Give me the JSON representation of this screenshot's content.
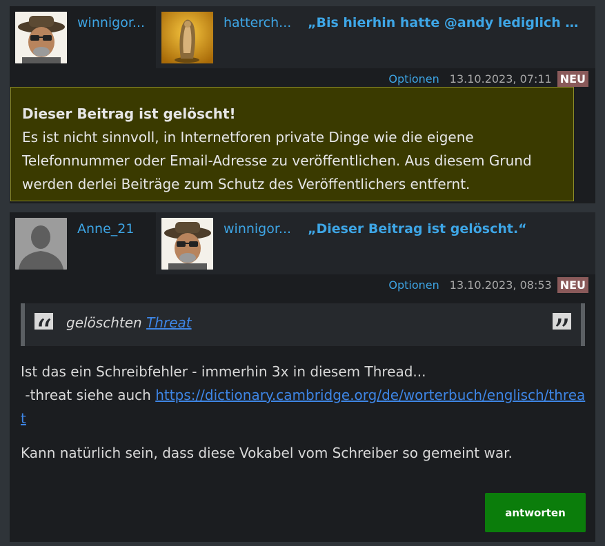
{
  "posts": [
    {
      "author": "winnigor...",
      "author_avatar_icon": "user-avatar-hat-icon",
      "reply_to": {
        "author": "hatterch...",
        "avatar_icon": "trophy-figure-avatar-icon",
        "quote": "„Bis hierhin hatte @andy lediglich m…"
      },
      "options_label": "Optionen",
      "timestamp": "13.10.2023, 07:11",
      "badge": "NEU",
      "deleted": {
        "title": "Dieser Beitrag ist gelöscht!",
        "text": "Es ist nicht sinnvoll, in Internetforen private Dinge wie die eigene Telefonnummer oder Email-Adresse zu veröffentlichen. Aus diesem Grund werden derlei Beiträge zum Schutz des Veröffentlichers entfernt."
      }
    },
    {
      "author": "Anne_21",
      "author_avatar_icon": "default-user-silhouette-icon",
      "reply_to": {
        "author": "winnigor...",
        "avatar_icon": "user-avatar-hat-icon",
        "quote": "„Dieser Beitrag ist gelöscht.“"
      },
      "options_label": "Optionen",
      "timestamp": "13.10.2023, 08:53",
      "badge": "NEU",
      "quote": {
        "prefix": "gelöschten",
        "link": "Threat"
      },
      "body": {
        "line1": "Ist das ein Schreibfehler - immerhin 3x in diesem Thread...",
        "line2_prefix": " -threat siehe auch ",
        "link": "https://dictionary.cambridge.org/de/worterbuch/englisch/threat",
        "paragraph2": "Kann natürlich sein, dass diese Vokabel vom Schreiber so gemeint war."
      },
      "reply_button": "antworten"
    }
  ],
  "colors": {
    "link": "#3ea6e6",
    "deleted_bg": "#3a3a00",
    "badge_bg": "#8a5a5a",
    "reply_button_bg": "#0b7d0b"
  }
}
